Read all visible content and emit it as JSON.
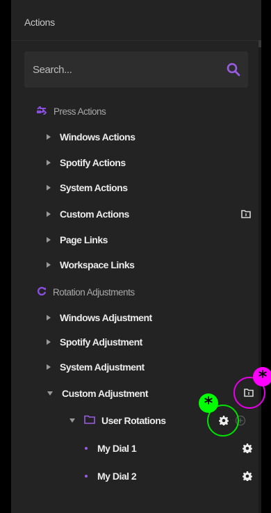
{
  "panel": {
    "title": "Actions"
  },
  "search": {
    "placeholder": "Search..."
  },
  "sections": [
    {
      "label": "Press Actions",
      "icon": "press-actions-icon"
    },
    {
      "label": "Rotation Adjustments",
      "icon": "rotation-icon"
    }
  ],
  "press_items": [
    {
      "label": "Windows Actions"
    },
    {
      "label": "Spotify Actions"
    },
    {
      "label": "System Actions"
    },
    {
      "label": "Custom Actions"
    },
    {
      "label": "Page Links"
    },
    {
      "label": "Workspace Links"
    }
  ],
  "rotation_items": [
    {
      "label": "Windows Adjustment"
    },
    {
      "label": "Spotify Adjustment"
    },
    {
      "label": "System Adjustment"
    },
    {
      "label": "Custom Adjustment"
    }
  ],
  "folder": {
    "label": "User Rotations"
  },
  "dials": [
    {
      "label": "My Dial 1"
    },
    {
      "label": "My Dial 2"
    }
  ],
  "annotations": {
    "star_symbol": "*"
  },
  "colors": {
    "accent": "#9b5de5",
    "magenta": "#ff00ff",
    "green": "#00ff00",
    "panel": "#232323"
  }
}
